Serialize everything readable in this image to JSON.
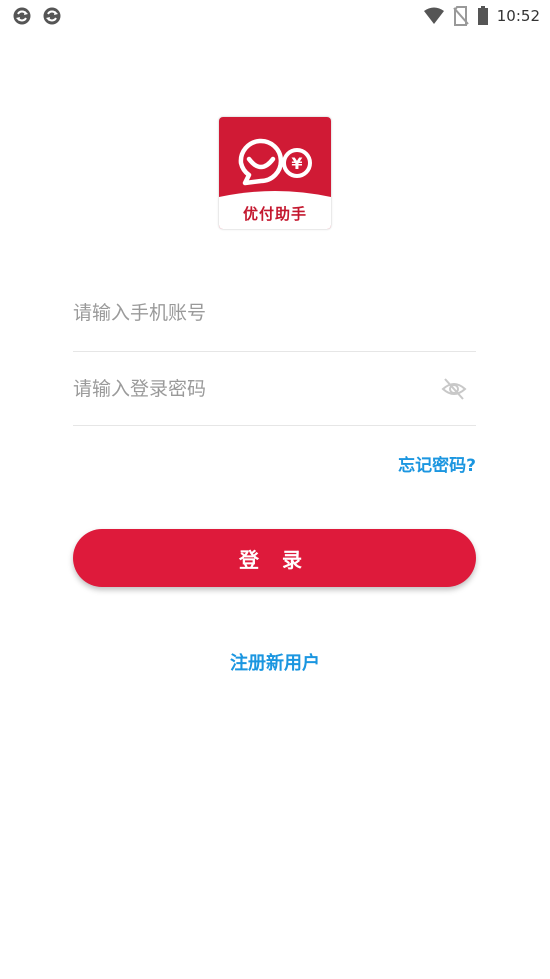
{
  "status_bar": {
    "time": "10:52",
    "left_icons": [
      "sync-icon",
      "sync-icon"
    ],
    "right_icons": [
      "wifi-icon",
      "no-sim-icon",
      "battery-icon"
    ]
  },
  "logo": {
    "text": "优付助手",
    "brand_color": "#c4182f"
  },
  "form": {
    "phone_placeholder": "请输入手机账号",
    "password_placeholder": "请输入登录密码",
    "forgot_label": "忘记密码?",
    "login_label": "登 录",
    "register_label": "注册新用户"
  },
  "colors": {
    "primary_red": "#de1a3b",
    "link_blue": "#1b96e0"
  }
}
